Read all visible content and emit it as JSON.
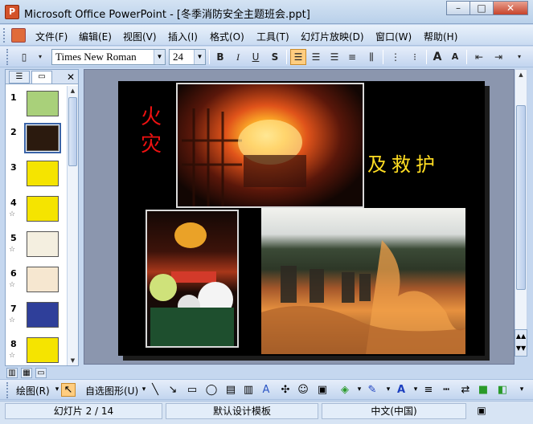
{
  "window": {
    "title": "Microsoft Office PowerPoint - [冬季消防安全主题班会.ppt]",
    "buttons": {
      "minimize": "–",
      "maximize": "□",
      "close": "✕"
    }
  },
  "menu": {
    "items": [
      "文件(F)",
      "编辑(E)",
      "视图(V)",
      "插入(I)",
      "格式(O)",
      "工具(T)",
      "幻灯片放映(D)",
      "窗口(W)",
      "帮助(H)"
    ]
  },
  "toolbar": {
    "font_name": "Times New Roman",
    "font_size": "24",
    "bold": "B",
    "italic": "I",
    "underline": "U",
    "shadow": "S",
    "increase_font": "A",
    "decrease_font": "A"
  },
  "slides_pane": {
    "slides": [
      {
        "number": "1",
        "color": "#a9d07a",
        "star": ""
      },
      {
        "number": "2",
        "color": "#2b1a0e",
        "star": ""
      },
      {
        "number": "3",
        "color": "#f5e400",
        "star": ""
      },
      {
        "number": "4",
        "color": "#f5e400",
        "star": "☆"
      },
      {
        "number": "5",
        "color": "#f4efe0",
        "star": "☆"
      },
      {
        "number": "6",
        "color": "#f6e7d0",
        "star": "☆"
      },
      {
        "number": "7",
        "color": "#2f3f9a",
        "star": "☆"
      },
      {
        "number": "8",
        "color": "#f5e400",
        "star": "☆"
      }
    ]
  },
  "slide": {
    "title_char_1": "火",
    "title_char_2": "灾",
    "caption": "及救护"
  },
  "drawing_toolbar": {
    "draw_label": "绘图(R)",
    "autoshapes_label": "自选图形(U)"
  },
  "status": {
    "slide_info": "幻灯片 2 / 14",
    "template": "默认设计模板",
    "language": "中文(中国)"
  },
  "colors": {
    "accent": "#ffcd80",
    "title_red": "#e11111",
    "caption_yellow": "#ffdd22"
  }
}
